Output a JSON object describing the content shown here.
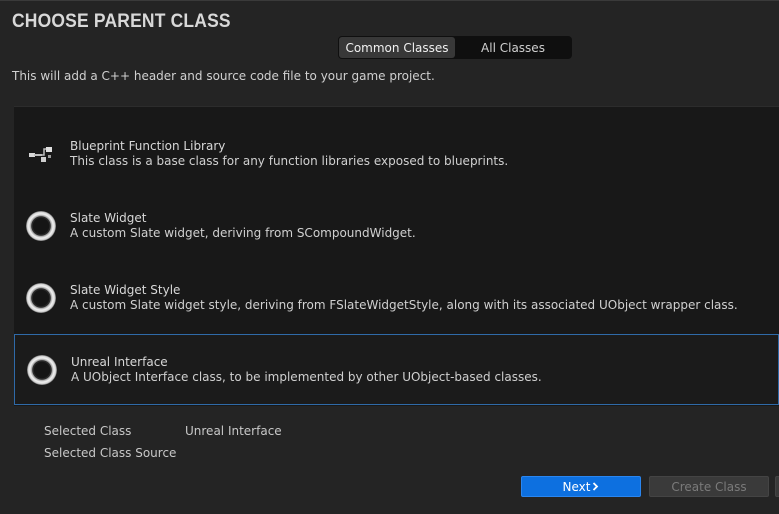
{
  "dialog": {
    "title": "CHOOSE PARENT CLASS",
    "subtitle": "This will add a C++ header and source code file to your game project."
  },
  "tabs": [
    {
      "label": "Common Classes",
      "active": true
    },
    {
      "label": "All Classes",
      "active": false
    }
  ],
  "classes": [
    {
      "name": "Blueprint Function Library",
      "description": "This class is a base class for any function libraries exposed to blueprints.",
      "icon": "blueprint-node-icon",
      "selected": false
    },
    {
      "name": "Slate Widget",
      "description": "A custom Slate widget, deriving from SCompoundWidget.",
      "icon": "class-ring-icon",
      "selected": false
    },
    {
      "name": "Slate Widget Style",
      "description": "A custom Slate widget style, deriving from FSlateWidgetStyle, along with its associated UObject wrapper class.",
      "icon": "class-ring-icon",
      "selected": false
    },
    {
      "name": "Unreal Interface",
      "description": "A UObject Interface class, to be implemented by other UObject-based classes.",
      "icon": "class-ring-icon",
      "selected": true
    }
  ],
  "selection": {
    "class_label": "Selected Class",
    "class_value": "Unreal Interface",
    "source_label": "Selected Class Source",
    "source_value": ""
  },
  "buttons": {
    "next": "Next",
    "create": "Create Class"
  },
  "colors": {
    "accent": "#0d70e0",
    "selection_border": "#2f6aa8",
    "background": "#242424"
  }
}
